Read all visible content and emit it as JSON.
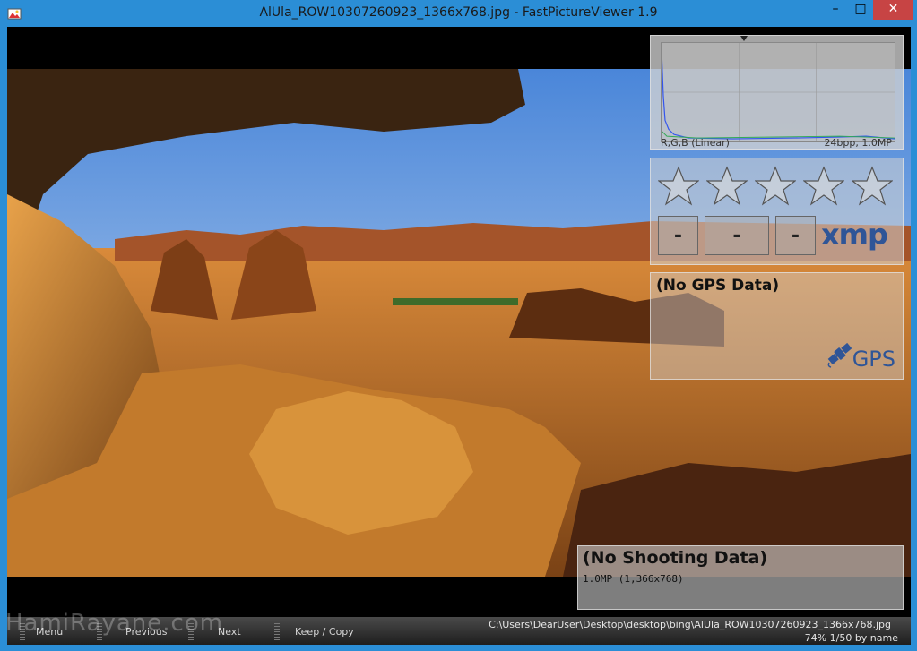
{
  "window": {
    "title": "AlUla_ROW10307260923_1366x768.jpg - FastPictureViewer 1.9",
    "minimize": "–",
    "maximize": "□",
    "close": "✕"
  },
  "histogram": {
    "channel_label": "R,G,B (Linear)",
    "info": "24bpp, 1.0MP"
  },
  "rating": {
    "star_count": 5,
    "filled": 0,
    "tag_boxes": [
      "-",
      "-",
      "-"
    ],
    "xmp_label": "xmp"
  },
  "gps": {
    "heading": "(No GPS Data)",
    "label": "GPS"
  },
  "shooting": {
    "heading": "(No Shooting Data)",
    "details": "1.0MP (1,366x768)"
  },
  "statusbar": {
    "menu": "Menu",
    "previous": "Previous",
    "next": "Next",
    "keep_copy": "Keep / Copy",
    "path": "C:\\Users\\DearUser\\Desktop\\desktop\\bing\\AlUla_ROW10307260923_1366x768.jpg",
    "zoom_info": "74%  1/50  by name"
  },
  "watermark": "HamiRayane.com",
  "colors": {
    "titlebar": "#2b8ed6",
    "close_button": "#c74444",
    "accent_blue": "#2f5597"
  }
}
